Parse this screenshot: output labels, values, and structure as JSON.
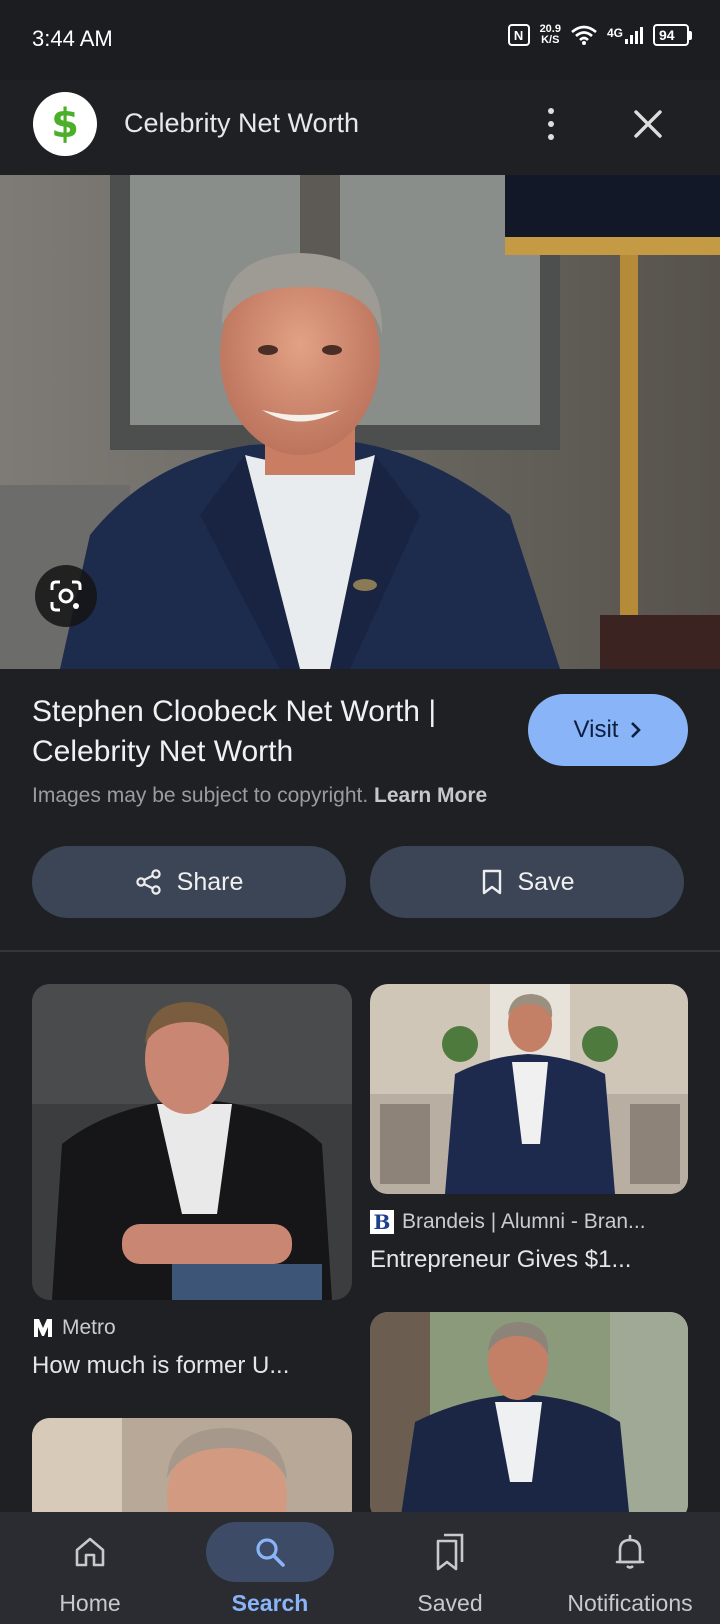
{
  "status_bar": {
    "time": "3:44 AM",
    "nfc": "N",
    "net_speed_value": "20.9",
    "net_speed_unit": "K/S",
    "network_type": "4G",
    "battery": "94"
  },
  "header": {
    "site_logo_symbol": "$",
    "site_name": "Celebrity Net Worth",
    "more_icon": "more-vert-icon",
    "close_icon": "close-icon"
  },
  "result": {
    "title": "Stephen Cloobeck Net Worth | Celebrity Net Worth",
    "visit_label": "Visit",
    "copyright_text": "Images may be subject to copyright.",
    "learn_more": "Learn More",
    "share_label": "Share",
    "save_label": "Save"
  },
  "related": [
    {
      "source": "Metro",
      "source_logo": "M",
      "title": "How much is former U..."
    },
    {
      "source": "Brandeis | Alumni - Bran...",
      "source_logo": "B",
      "title": "Entrepreneur Gives $1..."
    }
  ],
  "bottom_nav": {
    "items": [
      {
        "label": "Home",
        "icon": "home-icon"
      },
      {
        "label": "Search",
        "icon": "search-icon",
        "active": true
      },
      {
        "label": "Saved",
        "icon": "bookmarks-icon"
      },
      {
        "label": "Notifications",
        "icon": "bell-icon"
      }
    ]
  },
  "colors": {
    "background": "#1f2023",
    "accent": "#8ab4f8",
    "button_bg": "#3c4556",
    "logo_green": "#4caf2a"
  }
}
